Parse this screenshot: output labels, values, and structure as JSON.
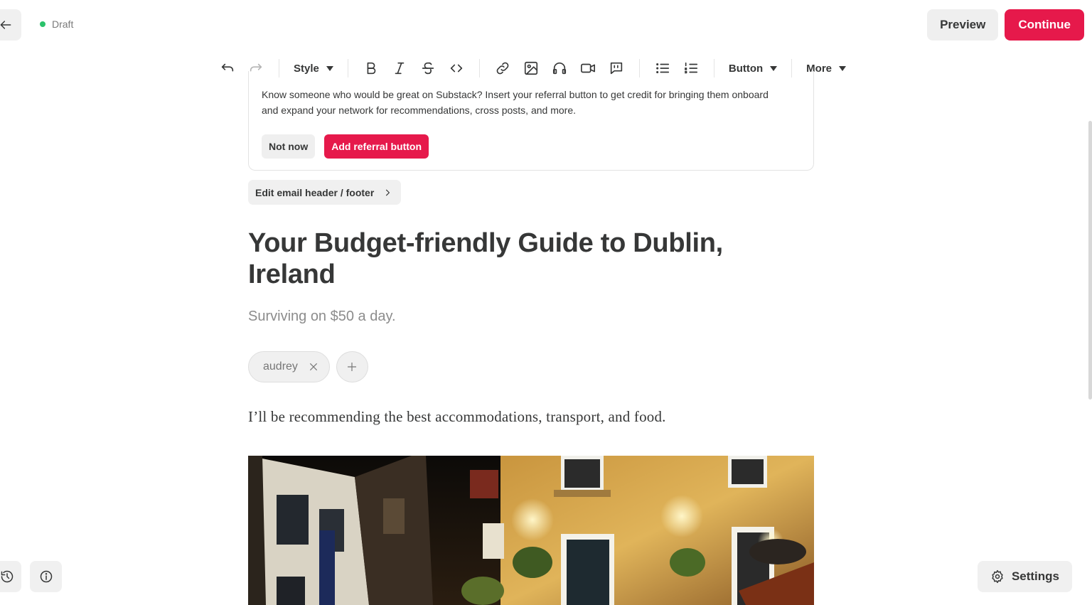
{
  "header": {
    "status_label": "Draft",
    "preview_label": "Preview",
    "continue_label": "Continue"
  },
  "toolbar": {
    "style_label": "Style",
    "button_label": "Button",
    "more_label": "More",
    "icons": [
      "undo-icon",
      "redo-icon",
      "bold-icon",
      "italic-icon",
      "strikethrough-icon",
      "code-icon",
      "link-icon",
      "image-icon",
      "audio-icon",
      "video-icon",
      "comment-icon",
      "bullet-list-icon",
      "numbered-list-icon"
    ]
  },
  "referral": {
    "text": "Know someone who would be great on Substack? Insert your referral button to get credit for bringing them onboard and expand your network for recommendations, cross posts, and more.",
    "not_now_label": "Not now",
    "add_label": "Add referral button"
  },
  "edit_header_label": "Edit email header / footer",
  "post": {
    "title": "Your Budget-friendly Guide to Dublin, Ireland",
    "subtitle": "Surviving on $50 a day.",
    "author": "audrey",
    "body": "I’ll be recommending the best accommodations, transport, and food."
  },
  "footer": {
    "settings_label": "Settings"
  },
  "colors": {
    "accent": "#e6194b",
    "status_dot": "#2bc26b",
    "text": "#363737"
  }
}
